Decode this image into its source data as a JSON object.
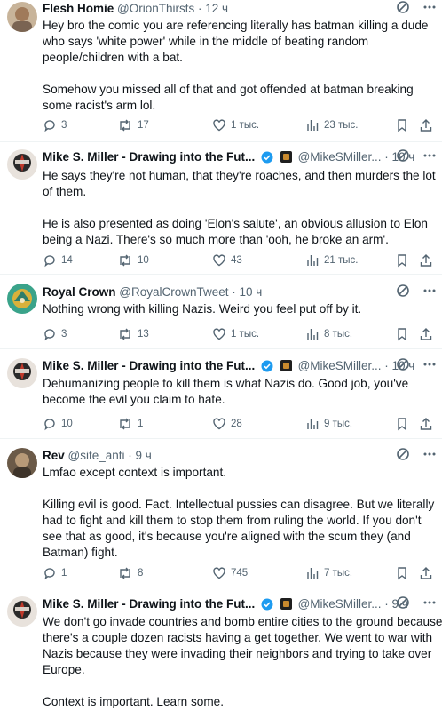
{
  "tweets": [
    {
      "name": "Flesh Homie",
      "handle": "@OrionThirsts",
      "time": " · 12 ч",
      "verified": false,
      "lines": [
        "Hey bro the comic you are referencing literally has batman killing a dude",
        "who says 'white power' while in the middle of beating random",
        "people/children with a bat.",
        "",
        "Somehow you missed all of that and got offended at batman breaking",
        "some racist's arm lol."
      ],
      "replies": "3",
      "reposts": "17",
      "likes": "1 тыс.",
      "views": "23 тыс."
    },
    {
      "name": "Mike S. Miller - Drawing into the Fut...",
      "handle": "@MikeSMiller...",
      "time": " · 10 ч",
      "verified": true,
      "lines": [
        "He says they're not human, that they're roaches, and then murders the lot",
        "of them.",
        "",
        "He is also presented as doing 'Elon's salute', an obvious allusion to Elon",
        "being a Nazi.  There's so much more than 'ooh, he broke an arm'."
      ],
      "replies": "14",
      "reposts": "10",
      "likes": "43",
      "views": "21 тыс."
    },
    {
      "name": "Royal Crown",
      "handle": "@RoyalCrownTweet",
      "time": " · 10 ч",
      "verified": false,
      "lines": [
        "Nothing wrong with killing Nazis. Weird you feel put off by it."
      ],
      "replies": "3",
      "reposts": "13",
      "likes": "1 тыс.",
      "views": "8 тыс."
    },
    {
      "name": "Mike S. Miller - Drawing into the Fut...",
      "handle": "@MikeSMiller...",
      "time": " · 10 ч",
      "verified": true,
      "lines": [
        "Dehumanizing people to kill them is what Nazis do.  Good job, you've",
        "become the evil you claim to hate."
      ],
      "replies": "10",
      "reposts": "1",
      "likes": "28",
      "views": "9 тыс."
    },
    {
      "name": "Rev",
      "handle": "@site_anti",
      "time": " · 9 ч",
      "verified": false,
      "lines": [
        "Lmfao except context is important.",
        "",
        "Killing evil is good. Fact. Intellectual pussies can disagree. But we literally",
        "had to fight and kill them to stop them from ruling the world. If you don't",
        "see that as good, it's because you're aligned with the scum they (and",
        "Batman) fight."
      ],
      "replies": "1",
      "reposts": "8",
      "likes": "745",
      "views": "7 тыс."
    },
    {
      "name": "Mike S. Miller - Drawing into the Fut...",
      "handle": "@MikeSMiller...",
      "time": " · 9 ч",
      "verified": true,
      "lines": [
        "We don't go invade countries and bomb entire cities to the ground because",
        "there's a couple dozen racists having a get together. We went to war with",
        "Nazis because they were invading their neighbors and trying to take over",
        "Europe.",
        "",
        "Context is important. Learn some."
      ],
      "replies": "",
      "reposts": "",
      "likes": "",
      "views": ""
    }
  ]
}
